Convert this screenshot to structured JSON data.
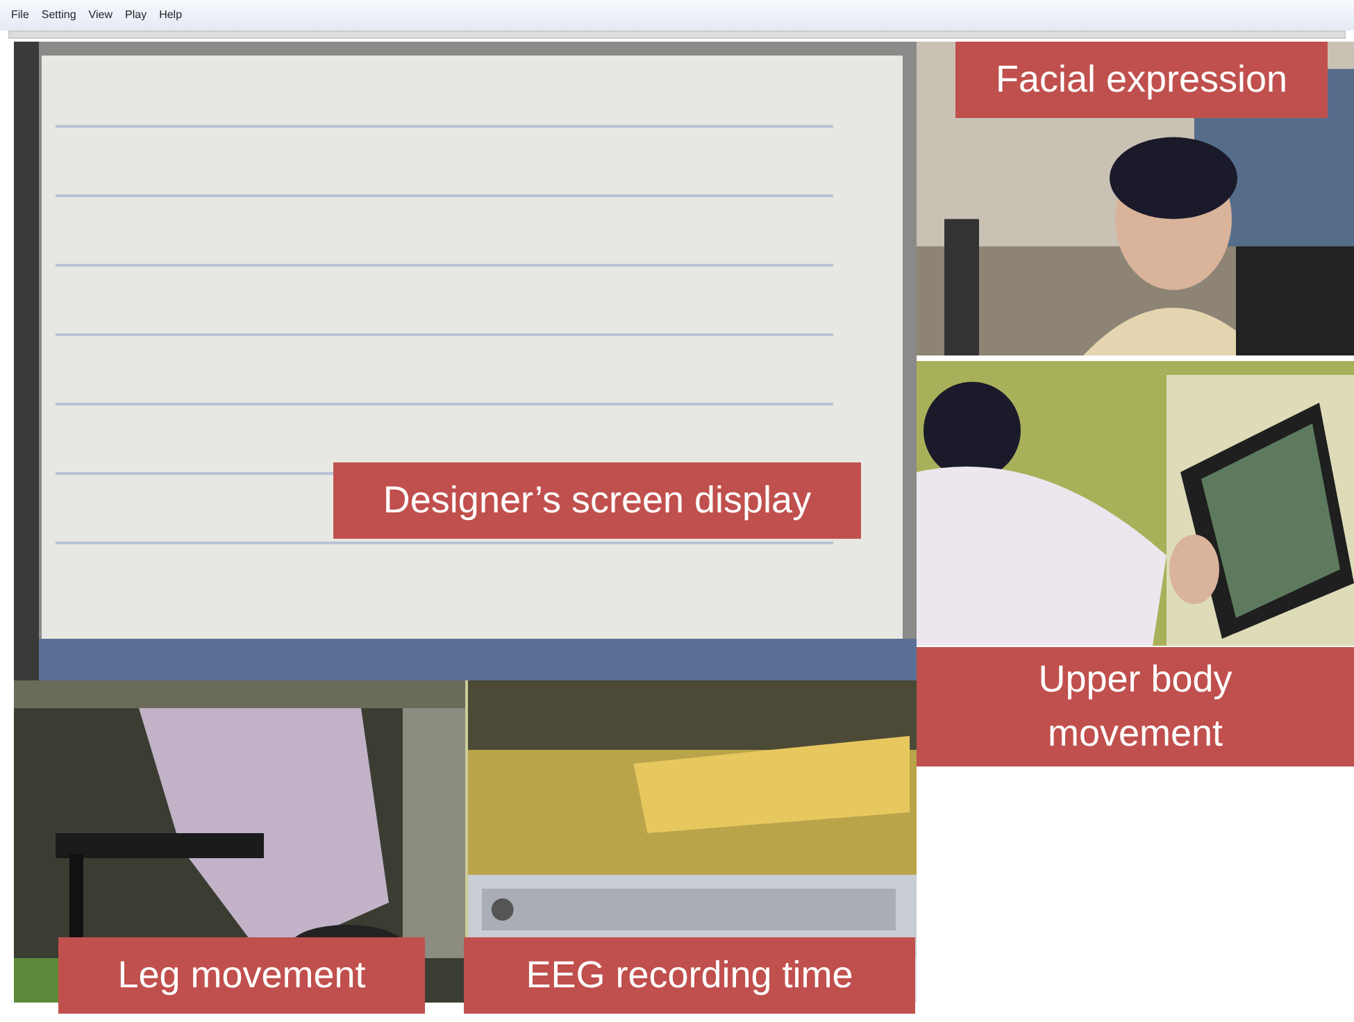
{
  "menu": [
    "File",
    "Setting",
    "View",
    "Play",
    "Help"
  ],
  "annotations": [
    {
      "text": "Facial expression"
    },
    {
      "text": "Designer’s screen display"
    },
    {
      "text": "Upper body movement"
    },
    {
      "text": "Leg movement"
    },
    {
      "text": "EEG recording time"
    }
  ]
}
